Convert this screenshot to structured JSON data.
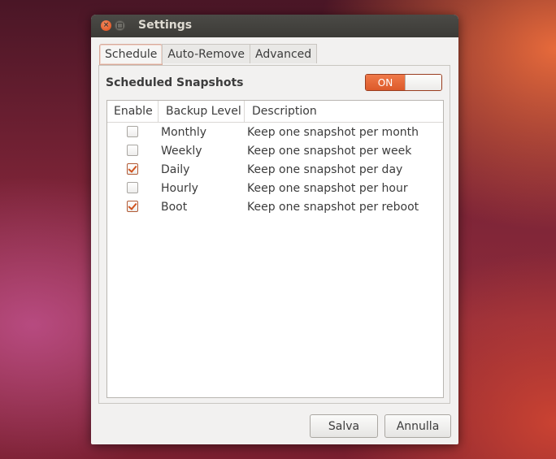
{
  "window": {
    "title": "Settings",
    "close_glyph": "×",
    "maximize_glyph": ""
  },
  "tabs": [
    {
      "label": "Schedule",
      "active": true
    },
    {
      "label": "Auto-Remove",
      "active": false
    },
    {
      "label": "Advanced",
      "active": false
    }
  ],
  "schedule": {
    "section_title": "Scheduled Snapshots",
    "toggle_label": "ON",
    "toggle_on": true,
    "columns": [
      "Enable",
      "Backup Level",
      "Description"
    ],
    "rows": [
      {
        "enabled": false,
        "level": "Monthly",
        "description": "Keep one snapshot per month"
      },
      {
        "enabled": false,
        "level": "Weekly",
        "description": "Keep one snapshot per week"
      },
      {
        "enabled": true,
        "level": "Daily",
        "description": "Keep one snapshot per day"
      },
      {
        "enabled": false,
        "level": "Hourly",
        "description": "Keep one snapshot per hour"
      },
      {
        "enabled": true,
        "level": "Boot",
        "description": "Keep one snapshot per reboot"
      }
    ]
  },
  "buttons": {
    "save_label": "Salva",
    "cancel_label": "Annulla"
  },
  "colors": {
    "accent": "#dd5a2a",
    "titlebar": "#3c3b37",
    "close_button": "#df4b16"
  }
}
